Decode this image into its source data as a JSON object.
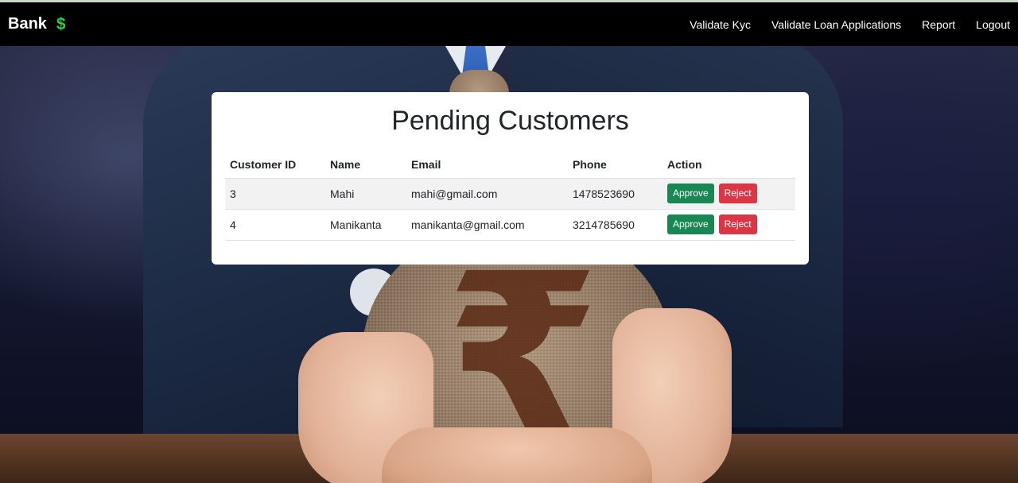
{
  "colors": {
    "navbar_bg": "#000000",
    "brand_icon": "#2ecc40",
    "approve": "#198754",
    "reject": "#dc3545"
  },
  "navbar": {
    "brand": "Bank",
    "brand_icon": "$",
    "links": [
      "Validate Kyc",
      "Validate Loan Applications",
      "Report",
      "Logout"
    ]
  },
  "background": {
    "icon": "rupee-money-bag-image",
    "rupee_glyph": "₹"
  },
  "card": {
    "title": "Pending Customers",
    "columns": [
      "Customer ID",
      "Name",
      "Email",
      "Phone",
      "Action"
    ],
    "rows": [
      {
        "id": "3",
        "name": "Mahi",
        "email": "mahi@gmail.com",
        "phone": "1478523690",
        "approve": "Approve",
        "reject": "Reject"
      },
      {
        "id": "4",
        "name": "Manikanta",
        "email": "manikanta@gmail.com",
        "phone": "3214785690",
        "approve": "Approve",
        "reject": "Reject"
      }
    ]
  }
}
